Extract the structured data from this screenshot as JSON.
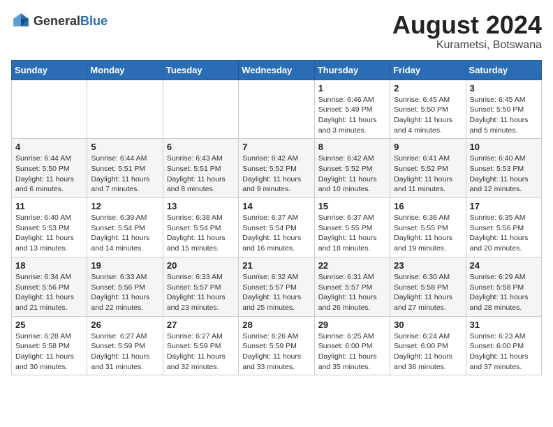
{
  "header": {
    "logo_general": "General",
    "logo_blue": "Blue",
    "title": "August 2024",
    "location": "Kurametsi, Botswana"
  },
  "weekdays": [
    "Sunday",
    "Monday",
    "Tuesday",
    "Wednesday",
    "Thursday",
    "Friday",
    "Saturday"
  ],
  "weeks": [
    [
      {
        "day": "",
        "detail": ""
      },
      {
        "day": "",
        "detail": ""
      },
      {
        "day": "",
        "detail": ""
      },
      {
        "day": "",
        "detail": ""
      },
      {
        "day": "1",
        "detail": "Sunrise: 6:46 AM\nSunset: 5:49 PM\nDaylight: 11 hours\nand 3 minutes."
      },
      {
        "day": "2",
        "detail": "Sunrise: 6:45 AM\nSunset: 5:50 PM\nDaylight: 11 hours\nand 4 minutes."
      },
      {
        "day": "3",
        "detail": "Sunrise: 6:45 AM\nSunset: 5:50 PM\nDaylight: 11 hours\nand 5 minutes."
      }
    ],
    [
      {
        "day": "4",
        "detail": "Sunrise: 6:44 AM\nSunset: 5:50 PM\nDaylight: 11 hours\nand 6 minutes."
      },
      {
        "day": "5",
        "detail": "Sunrise: 6:44 AM\nSunset: 5:51 PM\nDaylight: 11 hours\nand 7 minutes."
      },
      {
        "day": "6",
        "detail": "Sunrise: 6:43 AM\nSunset: 5:51 PM\nDaylight: 11 hours\nand 8 minutes."
      },
      {
        "day": "7",
        "detail": "Sunrise: 6:42 AM\nSunset: 5:52 PM\nDaylight: 11 hours\nand 9 minutes."
      },
      {
        "day": "8",
        "detail": "Sunrise: 6:42 AM\nSunset: 5:52 PM\nDaylight: 11 hours\nand 10 minutes."
      },
      {
        "day": "9",
        "detail": "Sunrise: 6:41 AM\nSunset: 5:52 PM\nDaylight: 11 hours\nand 11 minutes."
      },
      {
        "day": "10",
        "detail": "Sunrise: 6:40 AM\nSunset: 5:53 PM\nDaylight: 11 hours\nand 12 minutes."
      }
    ],
    [
      {
        "day": "11",
        "detail": "Sunrise: 6:40 AM\nSunset: 5:53 PM\nDaylight: 11 hours\nand 13 minutes."
      },
      {
        "day": "12",
        "detail": "Sunrise: 6:39 AM\nSunset: 5:54 PM\nDaylight: 11 hours\nand 14 minutes."
      },
      {
        "day": "13",
        "detail": "Sunrise: 6:38 AM\nSunset: 5:54 PM\nDaylight: 11 hours\nand 15 minutes."
      },
      {
        "day": "14",
        "detail": "Sunrise: 6:37 AM\nSunset: 5:54 PM\nDaylight: 11 hours\nand 16 minutes."
      },
      {
        "day": "15",
        "detail": "Sunrise: 6:37 AM\nSunset: 5:55 PM\nDaylight: 11 hours\nand 18 minutes."
      },
      {
        "day": "16",
        "detail": "Sunrise: 6:36 AM\nSunset: 5:55 PM\nDaylight: 11 hours\nand 19 minutes."
      },
      {
        "day": "17",
        "detail": "Sunrise: 6:35 AM\nSunset: 5:56 PM\nDaylight: 11 hours\nand 20 minutes."
      }
    ],
    [
      {
        "day": "18",
        "detail": "Sunrise: 6:34 AM\nSunset: 5:56 PM\nDaylight: 11 hours\nand 21 minutes."
      },
      {
        "day": "19",
        "detail": "Sunrise: 6:33 AM\nSunset: 5:56 PM\nDaylight: 11 hours\nand 22 minutes."
      },
      {
        "day": "20",
        "detail": "Sunrise: 6:33 AM\nSunset: 5:57 PM\nDaylight: 11 hours\nand 23 minutes."
      },
      {
        "day": "21",
        "detail": "Sunrise: 6:32 AM\nSunset: 5:57 PM\nDaylight: 11 hours\nand 25 minutes."
      },
      {
        "day": "22",
        "detail": "Sunrise: 6:31 AM\nSunset: 5:57 PM\nDaylight: 11 hours\nand 26 minutes."
      },
      {
        "day": "23",
        "detail": "Sunrise: 6:30 AM\nSunset: 5:58 PM\nDaylight: 11 hours\nand 27 minutes."
      },
      {
        "day": "24",
        "detail": "Sunrise: 6:29 AM\nSunset: 5:58 PM\nDaylight: 11 hours\nand 28 minutes."
      }
    ],
    [
      {
        "day": "25",
        "detail": "Sunrise: 6:28 AM\nSunset: 5:58 PM\nDaylight: 11 hours\nand 30 minutes."
      },
      {
        "day": "26",
        "detail": "Sunrise: 6:27 AM\nSunset: 5:59 PM\nDaylight: 11 hours\nand 31 minutes."
      },
      {
        "day": "27",
        "detail": "Sunrise: 6:27 AM\nSunset: 5:59 PM\nDaylight: 11 hours\nand 32 minutes."
      },
      {
        "day": "28",
        "detail": "Sunrise: 6:26 AM\nSunset: 5:59 PM\nDaylight: 11 hours\nand 33 minutes."
      },
      {
        "day": "29",
        "detail": "Sunrise: 6:25 AM\nSunset: 6:00 PM\nDaylight: 11 hours\nand 35 minutes."
      },
      {
        "day": "30",
        "detail": "Sunrise: 6:24 AM\nSunset: 6:00 PM\nDaylight: 11 hours\nand 36 minutes."
      },
      {
        "day": "31",
        "detail": "Sunrise: 6:23 AM\nSunset: 6:00 PM\nDaylight: 11 hours\nand 37 minutes."
      }
    ]
  ]
}
